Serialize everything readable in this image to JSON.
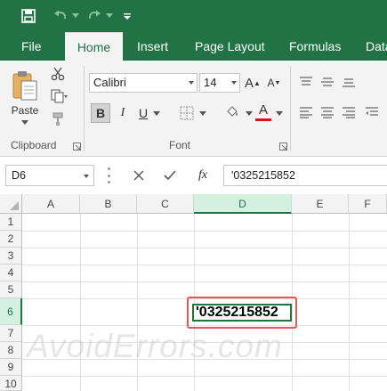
{
  "colors": {
    "brand": "#217346",
    "highlight": "#e05a5a",
    "font_color_bar": "#e01010"
  },
  "quick_access": {
    "save_icon": "save-icon",
    "undo_icon": "undo-icon",
    "redo_icon": "redo-icon",
    "customize_icon": "customize-qat-icon"
  },
  "tabs": [
    "File",
    "Home",
    "Insert",
    "Page Layout",
    "Formulas",
    "Data"
  ],
  "active_tab": "Home",
  "ribbon": {
    "clipboard": {
      "paste_label": "Paste",
      "group_label": "Clipboard"
    },
    "font": {
      "font_name": "Calibri",
      "font_size": "14",
      "group_label": "Font",
      "bold": "B",
      "italic": "I",
      "underline": "U",
      "font_color_letter": "A",
      "grow_label": "A",
      "shrink_label": "A"
    }
  },
  "formula_bar": {
    "name_box": "D6",
    "fx_label": "fx",
    "formula": "'0325215852"
  },
  "sheet": {
    "columns": [
      "A",
      "B",
      "C",
      "D",
      "E",
      "F"
    ],
    "rows": [
      "1",
      "2",
      "3",
      "4",
      "5",
      "6",
      "7",
      "8",
      "9",
      "10"
    ],
    "selected_column": "D",
    "selected_row": "6",
    "active_cell_value": "'0325215852"
  },
  "watermark": "AvoidErrors.com"
}
